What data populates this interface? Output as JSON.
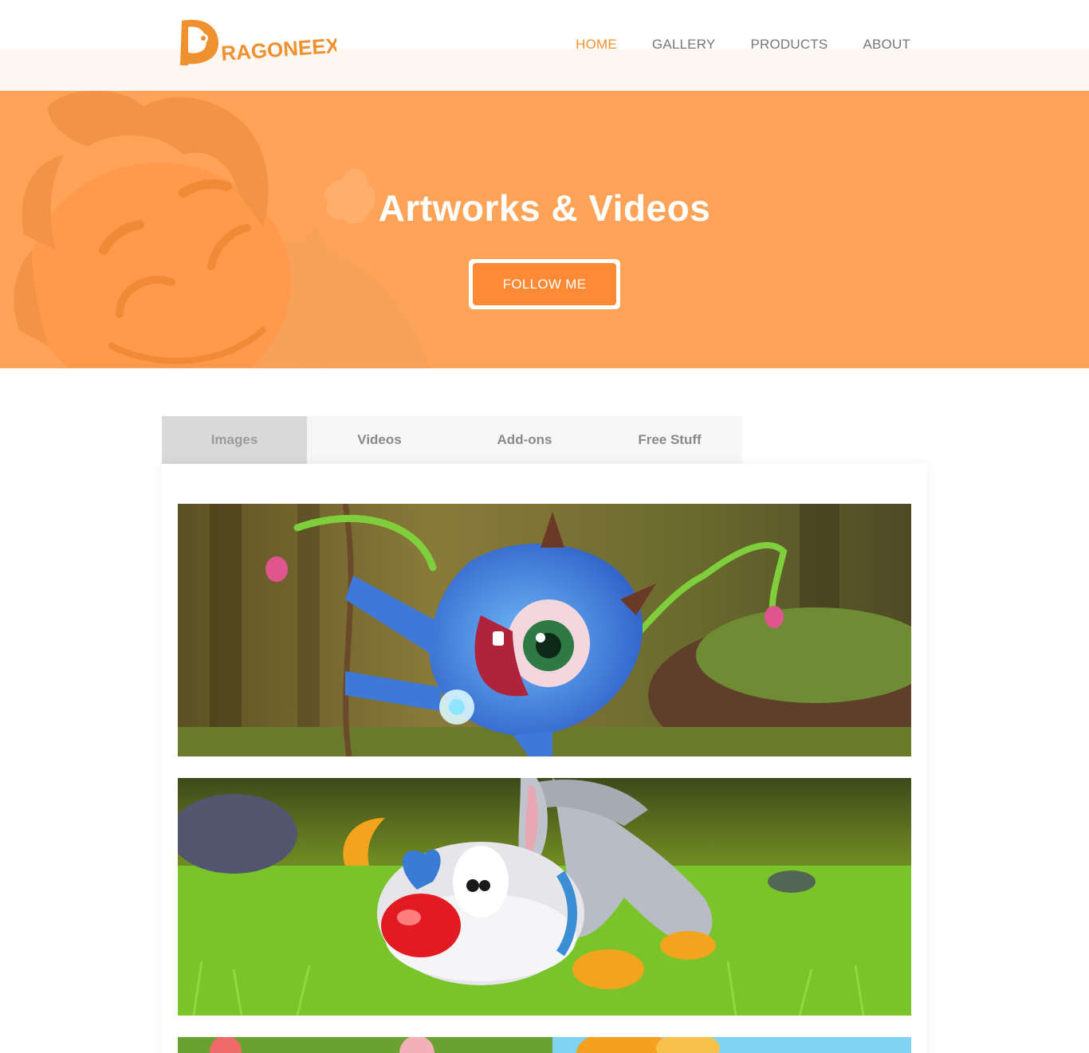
{
  "brand": {
    "logo_text": "DRAGONEEX"
  },
  "nav": {
    "items": [
      {
        "label": "HOME",
        "active": true
      },
      {
        "label": "GALLERY",
        "active": false
      },
      {
        "label": "PRODUCTS",
        "active": false
      },
      {
        "label": "ABOUT",
        "active": false
      }
    ]
  },
  "hero": {
    "title": "Artworks & Videos",
    "button_label": "FOLLOW ME"
  },
  "tabs": [
    {
      "label": "Images",
      "active": true
    },
    {
      "label": "Videos",
      "active": false
    },
    {
      "label": "Add-ons",
      "active": false
    },
    {
      "label": "Free Stuff",
      "active": false
    }
  ],
  "gallery": {
    "images": [
      {
        "subject": "blue-one-eyed-monster"
      },
      {
        "subject": "gray-rabbit-in-grass"
      },
      {
        "subject": "flowers-and-yellow-creature"
      }
    ]
  },
  "colors": {
    "accent": "#f5902e",
    "hero_bg": "#ffa358",
    "button_bg": "#ff8a36",
    "tab_active_bg": "#d9d9d9",
    "tab_bg": "#f6f6f6"
  }
}
